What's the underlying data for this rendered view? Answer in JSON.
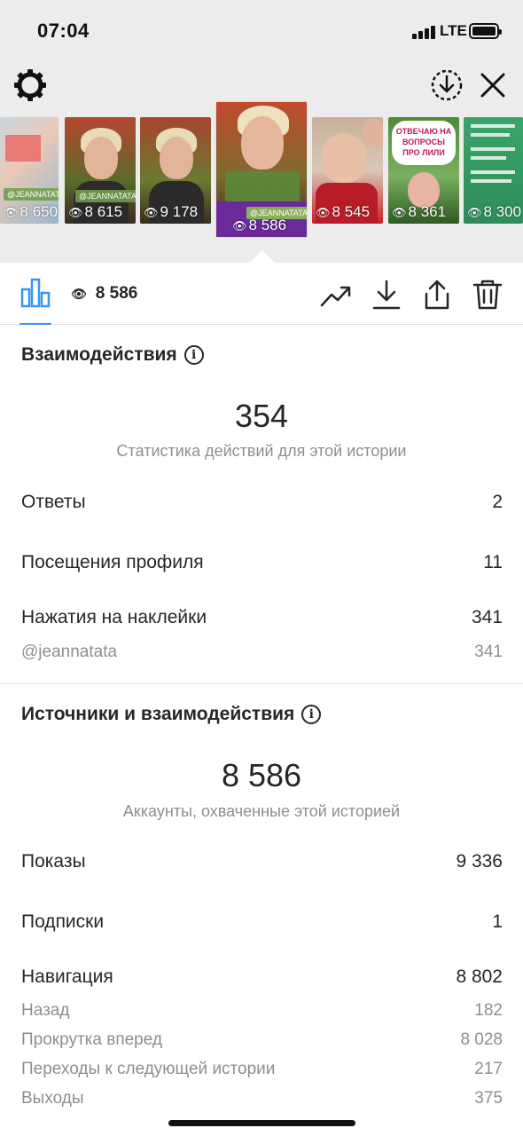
{
  "status_bar": {
    "time": "07:04",
    "network": "LTE"
  },
  "top_icons": [
    "settings-icon",
    "download-circle-icon",
    "close-icon"
  ],
  "stories": [
    {
      "views": "8 650",
      "tag": "@JEANNATATA"
    },
    {
      "views": "8 615",
      "tag": "@JEANNATATA"
    },
    {
      "views": "9 178",
      "tag": ""
    },
    {
      "views": "8 586",
      "tag": "@JEANNATATA",
      "active": true
    },
    {
      "views": "8 545",
      "tag": ""
    },
    {
      "views": "8 361",
      "tag": "ОТВЕЧАЮ НА ВОПРОСЫ ПРО ЛИЛИ"
    },
    {
      "views": "8 300",
      "tag": ""
    }
  ],
  "toolbar": {
    "views": "8 586",
    "icons": [
      "bar-chart-icon",
      "eye-icon",
      "trending-icon",
      "download-icon",
      "share-icon",
      "trash-icon"
    ]
  },
  "interactions": {
    "title": "Взаимодействия",
    "total": "354",
    "total_caption": "Статистика действий для этой истории",
    "rows": [
      {
        "label": "Ответы",
        "value": "2"
      },
      {
        "label": "Посещения профиля",
        "value": "11"
      },
      {
        "label": "Нажатия на наклейки",
        "value": "341"
      }
    ],
    "sub_rows": [
      {
        "label": "@jeannatata",
        "value": "341"
      }
    ]
  },
  "discovery": {
    "title": "Источники и взаимодействия",
    "total": "8 586",
    "total_caption": "Аккаунты, охваченные этой историей",
    "rows": [
      {
        "label": "Показы",
        "value": "9 336"
      },
      {
        "label": "Подписки",
        "value": "1"
      },
      {
        "label": "Навигация",
        "value": "8 802"
      }
    ],
    "sub_rows": [
      {
        "label": "Назад",
        "value": "182"
      },
      {
        "label": "Прокрутка вперед",
        "value": "8 028"
      },
      {
        "label": "Переходы к следующей истории",
        "value": "217"
      },
      {
        "label": "Выходы",
        "value": "375"
      }
    ]
  },
  "colors": {
    "accent": "#3797f0",
    "muted": "#8e8e8e",
    "text": "#262626"
  }
}
